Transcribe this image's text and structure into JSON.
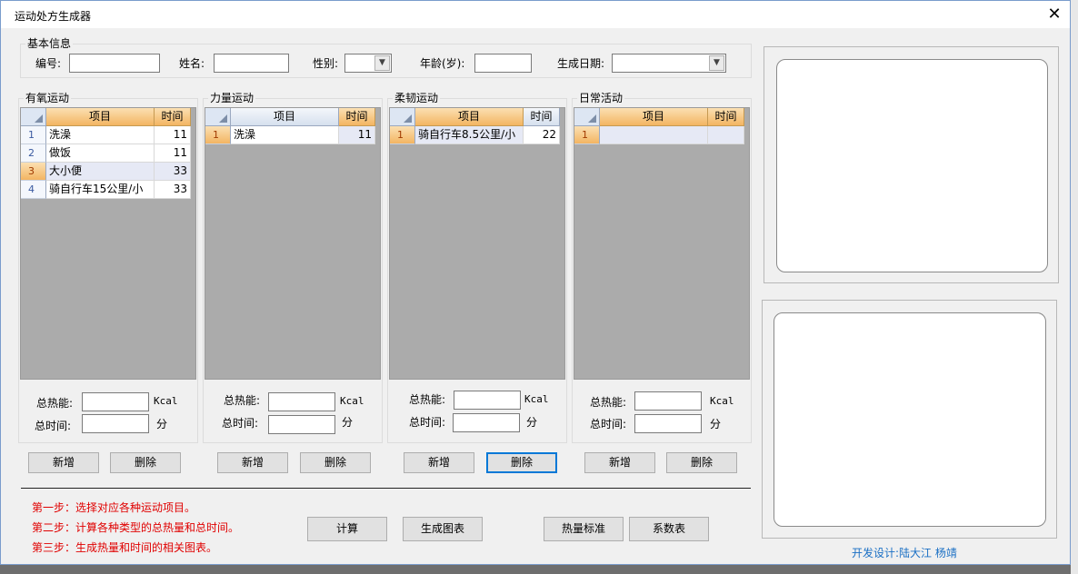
{
  "window": {
    "title": "运动处方生成器",
    "close_glyph": "✕"
  },
  "basic": {
    "group_title": "基本信息",
    "id_label": "编号:",
    "name_label": "姓名:",
    "gender_label": "性别:",
    "age_label": "年龄(岁):",
    "date_label": "生成日期:",
    "id_value": "",
    "name_value": "",
    "age_value": "",
    "gender_value": "",
    "date_value": ""
  },
  "columns": {
    "item": "项目",
    "time": "时间"
  },
  "totals": {
    "energy_label": "总热能:",
    "time_label": "总时间:",
    "energy_unit": "Kcal",
    "time_unit": "分"
  },
  "buttons": {
    "add": "新增",
    "delete": "删除"
  },
  "aerobic": {
    "title": "有氧运动",
    "rows": [
      {
        "idx": "1",
        "item": "洗澡",
        "time": "11"
      },
      {
        "idx": "2",
        "item": "做饭",
        "time": "11"
      },
      {
        "idx": "3",
        "item": "大小便",
        "time": "33"
      },
      {
        "idx": "4",
        "item": "骑自行车15公里/小",
        "time": "33"
      }
    ]
  },
  "strength": {
    "title": "力量运动",
    "rows": [
      {
        "idx": "1",
        "item": "洗澡",
        "time": "11"
      }
    ]
  },
  "flex": {
    "title": "柔韧运动",
    "rows": [
      {
        "idx": "1",
        "item": "骑自行车8.5公里/小",
        "time": "22"
      }
    ]
  },
  "daily": {
    "title": "日常活动",
    "rows": [
      {
        "idx": "1",
        "item": "",
        "time": ""
      }
    ]
  },
  "steps": {
    "step1": "第一步：选择对应各种运动项目。",
    "step2": "第二步：计算各种类型的总热量和总时间。",
    "step3": "第三步：生成热量和时间的相关图表。"
  },
  "actions": {
    "calc": "计算",
    "chart": "生成图表",
    "standard": "热量标准",
    "coef": "系数表"
  },
  "footer": "开发设计:陆大江  杨靖",
  "colors": {
    "accent": "#0078d7",
    "header_orange": "#f3b562",
    "step_red": "#e00000",
    "footer_blue": "#1a6fc4"
  }
}
